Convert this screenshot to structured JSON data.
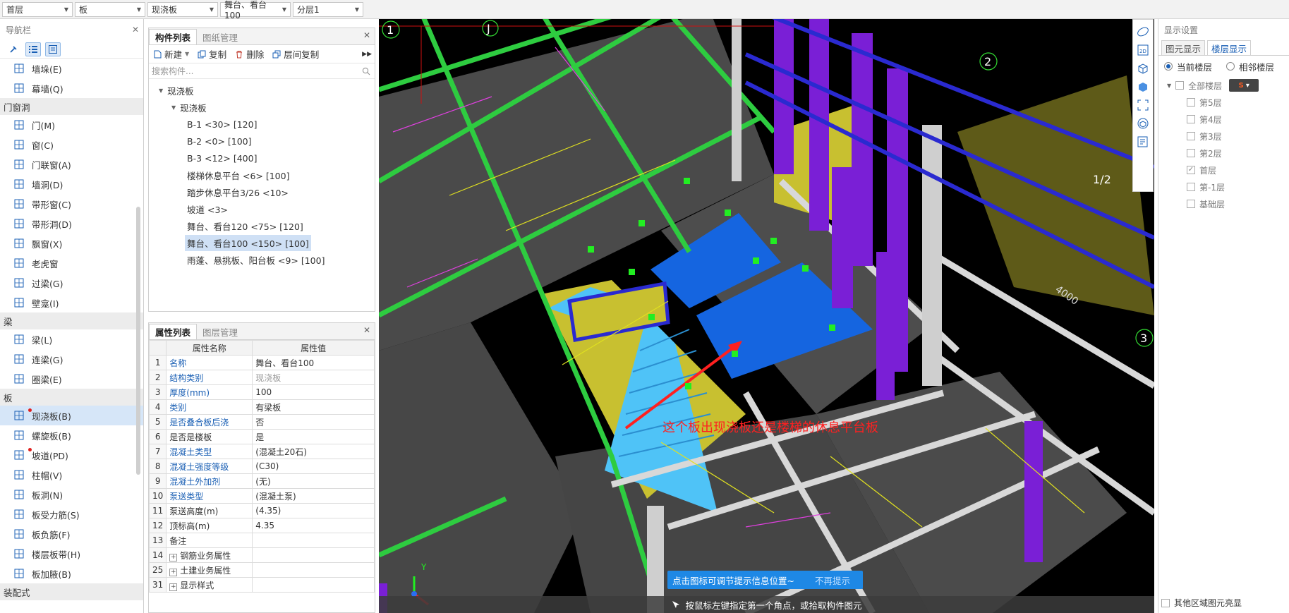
{
  "topbar": {
    "floor": "首层",
    "category": "板",
    "type": "现浇板",
    "component": "舞台、看台100",
    "layer": "分层1"
  },
  "nav": {
    "title": "导航栏",
    "groups": [
      {
        "category": "",
        "items": [
          {
            "label": "墙垛(E)",
            "icon": "wall-pier-icon"
          },
          {
            "label": "幕墙(Q)",
            "icon": "curtain-wall-icon"
          }
        ]
      },
      {
        "category": "门窗洞",
        "items": [
          {
            "label": "门(M)",
            "icon": "door-icon"
          },
          {
            "label": "窗(C)",
            "icon": "window-icon"
          },
          {
            "label": "门联窗(A)",
            "icon": "door-window-icon"
          },
          {
            "label": "墙洞(D)",
            "icon": "wall-opening-icon"
          },
          {
            "label": "带形窗(C)",
            "icon": "strip-window-icon"
          },
          {
            "label": "带形洞(D)",
            "icon": "strip-opening-icon"
          },
          {
            "label": "飘窗(X)",
            "icon": "bay-window-icon"
          },
          {
            "label": "老虎窗",
            "icon": "dormer-icon"
          },
          {
            "label": "过梁(G)",
            "icon": "lintel-icon"
          },
          {
            "label": "壁龛(I)",
            "icon": "niche-icon"
          }
        ]
      },
      {
        "category": "梁",
        "items": [
          {
            "label": "梁(L)",
            "icon": "beam-icon"
          },
          {
            "label": "连梁(G)",
            "icon": "coupling-beam-icon"
          },
          {
            "label": "圈梁(E)",
            "icon": "ring-beam-icon"
          }
        ]
      },
      {
        "category": "板",
        "items": [
          {
            "label": "现浇板(B)",
            "icon": "cast-slab-icon",
            "selected": true,
            "dot": true
          },
          {
            "label": "螺旋板(B)",
            "icon": "spiral-slab-icon"
          },
          {
            "label": "坡道(PD)",
            "icon": "ramp-icon",
            "dot": true
          },
          {
            "label": "柱帽(V)",
            "icon": "column-cap-icon"
          },
          {
            "label": "板洞(N)",
            "icon": "slab-hole-icon"
          },
          {
            "label": "板受力筋(S)",
            "icon": "slab-rebar-icon"
          },
          {
            "label": "板负筋(F)",
            "icon": "slab-neg-rebar-icon"
          },
          {
            "label": "楼层板带(H)",
            "icon": "slab-strip-icon"
          },
          {
            "label": "板加腋(B)",
            "icon": "slab-haunch-icon"
          }
        ]
      },
      {
        "category": "装配式",
        "items": []
      }
    ]
  },
  "components": {
    "tabs": [
      "构件列表",
      "图纸管理"
    ],
    "toolbar": {
      "new": "新建",
      "copy": "复制",
      "delete": "删除",
      "floor_copy": "层间复制"
    },
    "search_placeholder": "搜索构件...",
    "root": "现浇板",
    "group": "现浇板",
    "items": [
      "B-1 <30> [120]",
      "B-2 <0> [100]",
      "B-3 <12> [400]",
      "楼梯休息平台 <6> [100]",
      "踏步休息平台3/26 <10>",
      "坡道 <3>",
      "舞台、看台120 <75> [120]",
      "舞台、看台100 <150> [100]",
      "雨蓬、悬挑板、阳台板 <9> [100]"
    ],
    "selected_index": 7
  },
  "properties": {
    "tabs": [
      "属性列表",
      "图层管理"
    ],
    "headers": [
      "属性名称",
      "属性值"
    ],
    "rows": [
      {
        "n": "1",
        "k": "名称",
        "v": "舞台、看台100",
        "blue": true
      },
      {
        "n": "2",
        "k": "结构类别",
        "v": "现浇板",
        "blue": true,
        "gray": true
      },
      {
        "n": "3",
        "k": "厚度(mm)",
        "v": "100",
        "blue": true
      },
      {
        "n": "4",
        "k": "类别",
        "v": "有梁板",
        "blue": true
      },
      {
        "n": "5",
        "k": "是否叠合板后浇",
        "v": "否",
        "blue": true
      },
      {
        "n": "6",
        "k": "是否是楼板",
        "v": "是"
      },
      {
        "n": "7",
        "k": "混凝土类型",
        "v": "(混凝土20石)",
        "blue": true
      },
      {
        "n": "8",
        "k": "混凝土强度等级",
        "v": "(C30)",
        "blue": true
      },
      {
        "n": "9",
        "k": "混凝土外加剂",
        "v": "(无)",
        "blue": true
      },
      {
        "n": "10",
        "k": "泵送类型",
        "v": "(混凝土泵)",
        "blue": true
      },
      {
        "n": "11",
        "k": "泵送高度(m)",
        "v": "(4.35)"
      },
      {
        "n": "12",
        "k": "顶标高(m)",
        "v": "4.35"
      },
      {
        "n": "13",
        "k": "备注",
        "v": ""
      },
      {
        "n": "14",
        "k": "钢筋业务属性",
        "v": "",
        "group": true
      },
      {
        "n": "25",
        "k": "土建业务属性",
        "v": "",
        "group": true
      },
      {
        "n": "31",
        "k": "显示样式",
        "v": "",
        "group": true
      }
    ]
  },
  "viewport": {
    "axis_labels": [
      "1",
      "J",
      "2",
      "1/2",
      "3",
      "4000"
    ],
    "annotation": "这个板出现浇板还是楼梯的休息平台板",
    "axis_y": "Y"
  },
  "hint": {
    "text": "点击图标可调节提示信息位置~",
    "dismiss": "不再提示"
  },
  "status": {
    "text": "按鼠标左键指定第一个角点，或拾取构件图元"
  },
  "display": {
    "title": "显示设置",
    "tabs": [
      "图元显示",
      "楼层显示"
    ],
    "radio_current": "当前楼层",
    "radio_adjacent": "相邻楼层",
    "all_floors": "全部楼层",
    "floors": [
      "第5层",
      "第4层",
      "第3层",
      "第2层",
      "首层",
      "第-1层",
      "基础层"
    ],
    "checked_floor": "首层",
    "bottom_option": "其他区域图元亮显"
  },
  "colors": {
    "accent": "#1e88e5",
    "slab_blue": "#1565e0",
    "stair_cyan": "#4fc3f7",
    "beam_green": "#2ecc40",
    "wall_yellow": "#c8c030",
    "column_purple": "#7a1fd6",
    "annotation_red": "#ff2020"
  }
}
